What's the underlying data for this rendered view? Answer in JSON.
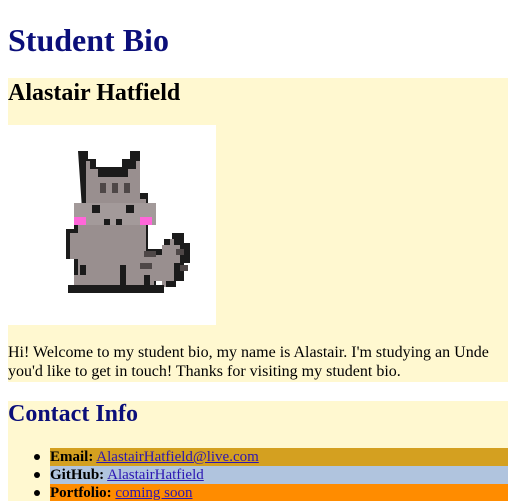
{
  "page": {
    "title": "Student Bio"
  },
  "bio": {
    "name": "Alastair Hatfield",
    "avatar_icon": "pixel-cat-icon",
    "intro_line1": "Hi! Welcome to my student bio, my name is Alastair. I'm studying an Unde",
    "intro_line2": "you'd like to get in touch! Thanks for visiting my student bio."
  },
  "contact": {
    "title": "Contact Info",
    "items": [
      {
        "label": "Email:",
        "value": "AlastairHatfield@live.com",
        "color": "#d4a020"
      },
      {
        "label": "GitHub:",
        "value": "AlastairHatfield",
        "color": "#b0c4de"
      },
      {
        "label": "Portfolio:",
        "value": "coming soon",
        "color": "#ff8c00"
      }
    ]
  },
  "colors": {
    "heading": "#0b0f7a",
    "section_background": "#fff8d0",
    "link": "#2b16b3"
  }
}
